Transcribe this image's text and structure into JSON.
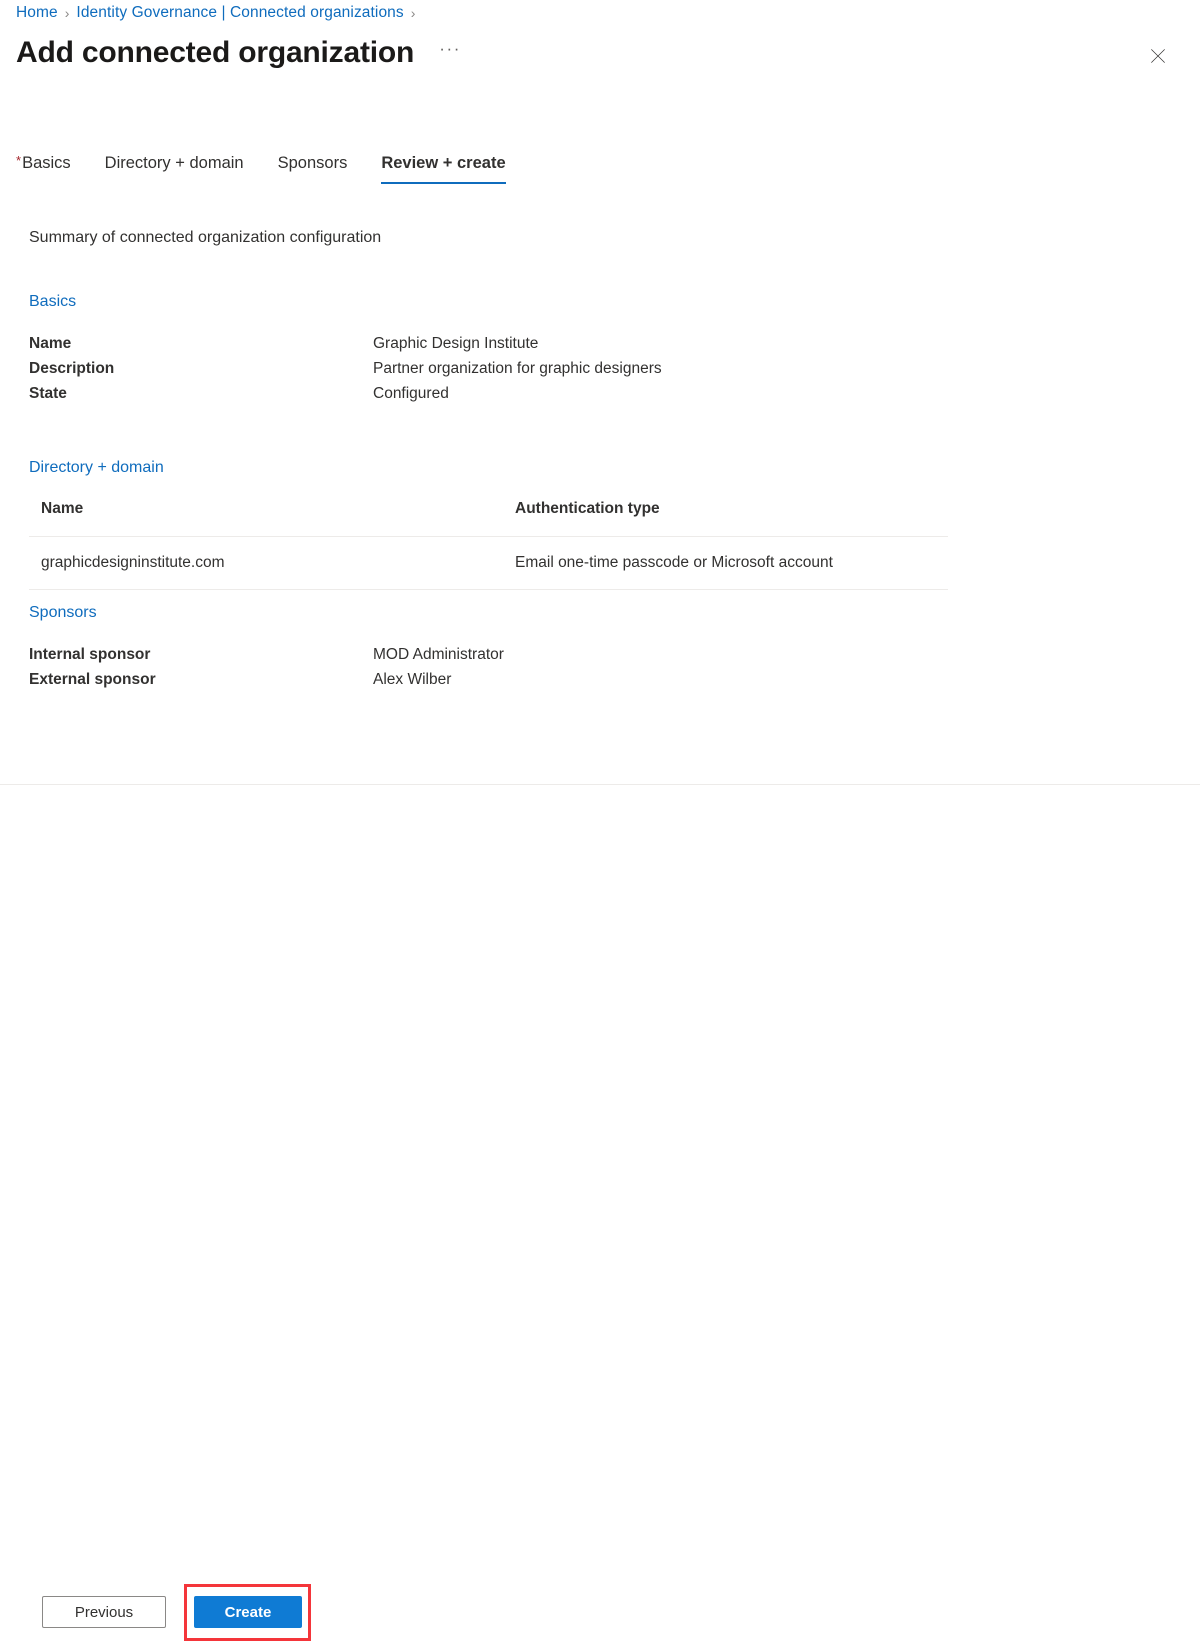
{
  "breadcrumb": {
    "separator": "›",
    "items": [
      {
        "label": "Home"
      },
      {
        "label": "Identity Governance | Connected organizations"
      }
    ]
  },
  "header": {
    "title": "Add connected organization",
    "ellipsis": "···",
    "close_icon": "close-icon"
  },
  "tabs": [
    {
      "label": "Basics",
      "required": true,
      "selected": false
    },
    {
      "label": "Directory + domain",
      "required": false,
      "selected": false
    },
    {
      "label": "Sponsors",
      "required": false,
      "selected": false
    },
    {
      "label": "Review + create",
      "required": false,
      "selected": true
    }
  ],
  "main": {
    "summary_text": "Summary of connected organization configuration",
    "sections": {
      "basics": {
        "heading": "Basics",
        "rows": [
          {
            "key": "Name",
            "value": "Graphic Design Institute"
          },
          {
            "key": "Description",
            "value": "Partner organization for graphic designers"
          },
          {
            "key": "State",
            "value": "Configured"
          }
        ]
      },
      "directory_domain": {
        "heading": "Directory + domain",
        "columns": [
          "Name",
          "Authentication type"
        ],
        "rows": [
          {
            "name": "graphicdesigninstitute.com",
            "authentication_type": "Email one-time passcode or Microsoft account"
          }
        ]
      },
      "sponsors": {
        "heading": "Sponsors",
        "rows": [
          {
            "key": "Internal sponsor",
            "value": "MOD Administrator"
          },
          {
            "key": "External sponsor",
            "value": "Alex Wilber"
          }
        ]
      }
    }
  },
  "footer": {
    "previous_label": "Previous",
    "create_label": "Create"
  },
  "colors": {
    "link_blue": "#0f6cbd",
    "primary_button": "#0f7bd4",
    "required_asterisk": "#a4262c",
    "highlight_red": "#f4353a",
    "divider": "#edebe9",
    "text": "#323130"
  }
}
